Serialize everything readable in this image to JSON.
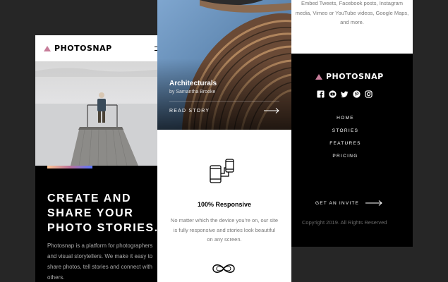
{
  "brand": {
    "name": "PHOTOSNAP"
  },
  "panel1": {
    "heading": "CREATE AND SHARE YOUR PHOTO STORIES.",
    "body": "Photosnap is a platform for photographers and visual storytellers. We make it easy to share photos, tell stories and connect with others."
  },
  "story": {
    "title": "Architecturals",
    "author": "by Samantha Brooke",
    "link": "READ STORY"
  },
  "feature": {
    "title": "100% Responsive",
    "text": "No matter which the device you’re on, our site is fully responsive and stories look beautiful on any screen."
  },
  "panel3": {
    "top_text": "Embed Tweets, Facebook posts, Instagram media, Vimeo or YouTube videos, Google Maps, and more."
  },
  "footer": {
    "nav": [
      "HOME",
      "STORIES",
      "FEATURES",
      "PRICING"
    ],
    "invite": "GET AN INVITE",
    "copyright": "Copyright 2019. All Rights Reserved",
    "socials": [
      "facebook-icon",
      "youtube-icon",
      "twitter-icon",
      "pinterest-icon",
      "instagram-icon"
    ]
  },
  "colors": {
    "background": "#262626",
    "dark": "#000000",
    "light": "#ffffff",
    "accent_gradient": [
      "#ffc593",
      "#bc7198",
      "#5a77ff"
    ]
  }
}
